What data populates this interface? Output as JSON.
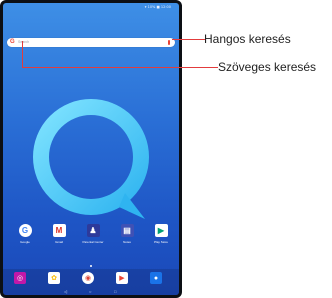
{
  "status_bar": {
    "text": "▾ 10% ■ 12:00"
  },
  "search_bar": {
    "logo": "G",
    "placeholder": "Search"
  },
  "apps": [
    {
      "label": "Google",
      "icon": "google-folder-icon"
    },
    {
      "label": "Gmail",
      "icon": "gmail-icon"
    },
    {
      "label": "Parental Center",
      "icon": "parental-center-icon"
    },
    {
      "label": "Notes",
      "icon": "notes-icon"
    },
    {
      "label": "Play Store",
      "icon": "play-store-icon"
    }
  ],
  "dock": [
    {
      "icon": "camera-icon"
    },
    {
      "icon": "photos-icon"
    },
    {
      "icon": "chrome-icon"
    },
    {
      "icon": "play-movies-icon"
    },
    {
      "icon": "contacts-icon"
    }
  ],
  "navigation": {
    "back": "◁",
    "home": "○",
    "recents": "□"
  },
  "callouts": {
    "voice_search": "Hangos keresés",
    "text_search": "Szöveges keresés"
  },
  "colors": {
    "wallpaper_top": "#3e8fe6",
    "wallpaper_bottom": "#1a48b8",
    "callout_line": "#e23c3c"
  }
}
